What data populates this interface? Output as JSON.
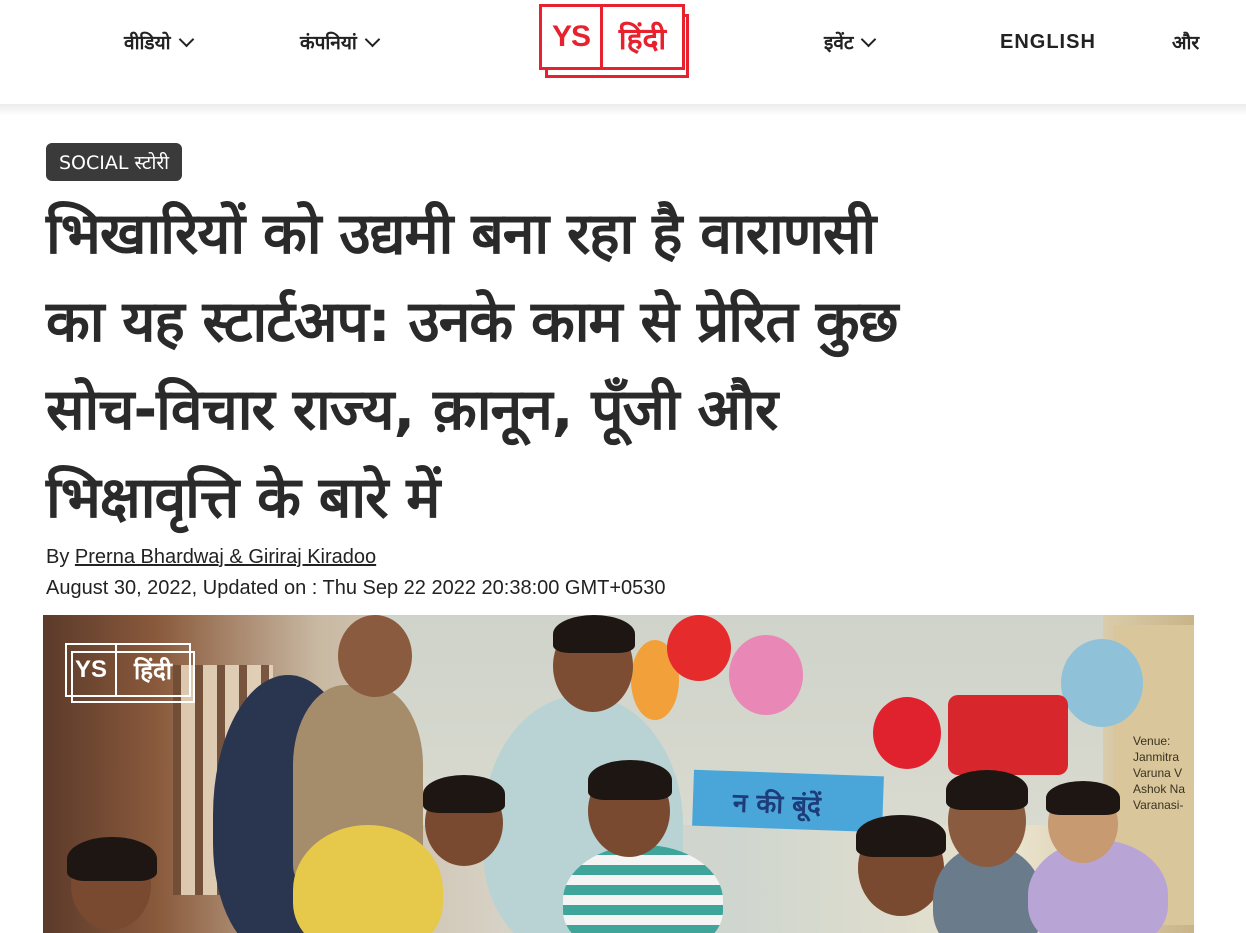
{
  "nav": {
    "left_items": [
      {
        "label": "वीडियो"
      },
      {
        "label": "कंपनियां"
      }
    ],
    "right_items": [
      {
        "label": "इवेंट"
      },
      {
        "label": "ENGLISH"
      },
      {
        "label": "और"
      }
    ]
  },
  "logo": {
    "ys": "YS",
    "hindi": "हिंदी"
  },
  "article": {
    "category": "SOCIAL स्टोरी",
    "headline_lines": [
      "भिखारियों को उद्यमी बना रहा है वाराणसी",
      "का यह स्टार्टअप: उनके काम से प्रेरित कुछ",
      "सोच-विचार राज्य, क़ानून, पूँजी और",
      "भिक्षावृत्ति के बारे में"
    ],
    "byline_prefix": "By",
    "authors": "Prerna Bhardwaj & Giriraj Kiradoo",
    "date": "August 30, 2022, Updated on : Thu Sep 22 2022 20:38:00 GMT+0530"
  },
  "hero": {
    "watermark_ys": "YS",
    "watermark_hindi": "हिंदी",
    "banner_text": "न की बूंदें",
    "poster_lines": [
      "Venue:",
      "Janmitra",
      "Varuna V",
      "Ashok Na",
      "Varanasi-"
    ]
  },
  "colors": {
    "brand_red": "#e8212e",
    "badge_bg": "#3a3a3a"
  }
}
